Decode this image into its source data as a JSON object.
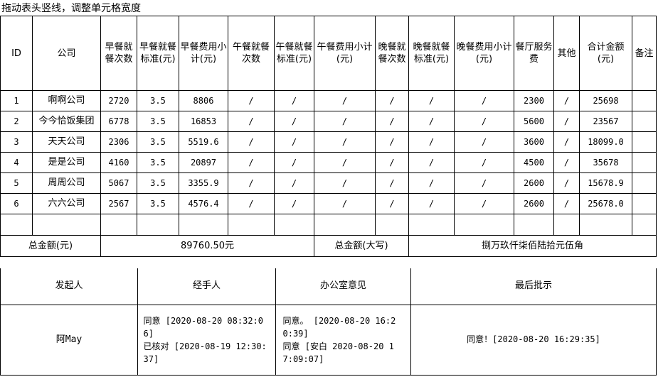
{
  "hint": "拖动表头竖线，调整单元格宽度",
  "headers": {
    "id": "ID",
    "company": "公司",
    "bf_count": "早餐就餐次数",
    "bf_std": "早餐就餐标准(元)",
    "bf_sub": "早餐费用小计(元)",
    "lu_count": "午餐就餐次数",
    "lu_std": "午餐就餐标准(元)",
    "lu_sub": "午餐费用小计(元)",
    "di_count": "晚餐就餐次数",
    "di_std": "晚餐就餐标准(元)",
    "di_sub": "晚餐费用小计(元)",
    "canteen": "餐厅服务费",
    "other": "其他",
    "total": "合计金额(元)",
    "remark": "备注"
  },
  "rows": [
    {
      "id": "1",
      "company": "啊啊公司",
      "bf_count": "2720",
      "bf_std": "3.5",
      "bf_sub": "8806",
      "lu_count": "/",
      "lu_std": "/",
      "lu_sub": "/",
      "di_count": "/",
      "di_std": "/",
      "di_sub": "/",
      "canteen": "2300",
      "other": "/",
      "total": "25698",
      "remark": ""
    },
    {
      "id": "2",
      "company": "今今恰饭集团",
      "bf_count": "6778",
      "bf_std": "3.5",
      "bf_sub": "16853",
      "lu_count": "/",
      "lu_std": "/",
      "lu_sub": "/",
      "di_count": "/",
      "di_std": "/",
      "di_sub": "/",
      "canteen": "5600",
      "other": "/",
      "total": "23567",
      "remark": ""
    },
    {
      "id": "3",
      "company": "天天公司",
      "bf_count": "2306",
      "bf_std": "3.5",
      "bf_sub": "5519.6",
      "lu_count": "/",
      "lu_std": "/",
      "lu_sub": "/",
      "di_count": "/",
      "di_std": "/",
      "di_sub": "/",
      "canteen": "3600",
      "other": "/",
      "total": "18099.0",
      "remark": ""
    },
    {
      "id": "4",
      "company": "是是公司",
      "bf_count": "4160",
      "bf_std": "3.5",
      "bf_sub": "20897",
      "lu_count": "/",
      "lu_std": "/",
      "lu_sub": "/",
      "di_count": "/",
      "di_std": "/",
      "di_sub": "/",
      "canteen": "4500",
      "other": "/",
      "total": "35678",
      "remark": ""
    },
    {
      "id": "5",
      "company": "周周公司",
      "bf_count": "5067",
      "bf_std": "3.5",
      "bf_sub": "3355.9",
      "lu_count": "/",
      "lu_std": "/",
      "lu_sub": "/",
      "di_count": "/",
      "di_std": "/",
      "di_sub": "/",
      "canteen": "2600",
      "other": "/",
      "total": "15678.9",
      "remark": ""
    },
    {
      "id": "6",
      "company": "六六公司",
      "bf_count": "2567",
      "bf_std": "3.5",
      "bf_sub": "4576.4",
      "lu_count": "/",
      "lu_std": "/",
      "lu_sub": "/",
      "di_count": "/",
      "di_std": "/",
      "di_sub": "/",
      "canteen": "2600",
      "other": "/",
      "total": "25678.0",
      "remark": ""
    }
  ],
  "summary": {
    "total_label": "总金额(元)",
    "total_value": "89760.50元",
    "upper_label": "总金额(大写)",
    "upper_value": "捌万玖仟柒佰陆拾元伍角"
  },
  "sign": {
    "initiator_label": "发起人",
    "handler_label": "经手人",
    "office_label": "办公室意见",
    "final_label": "最后批示",
    "initiator": "阿May",
    "handler": [
      "同意 [2020-08-20 08:32:06]",
      "已核对 [2020-08-19 12:30:37]"
    ],
    "office": [
      "同意。 [2020-08-20 16:20:39]",
      "同意 [安白 2020-08-20 17:09:07]"
    ],
    "final": "同意！[2020-08-20 16:29:35]"
  }
}
